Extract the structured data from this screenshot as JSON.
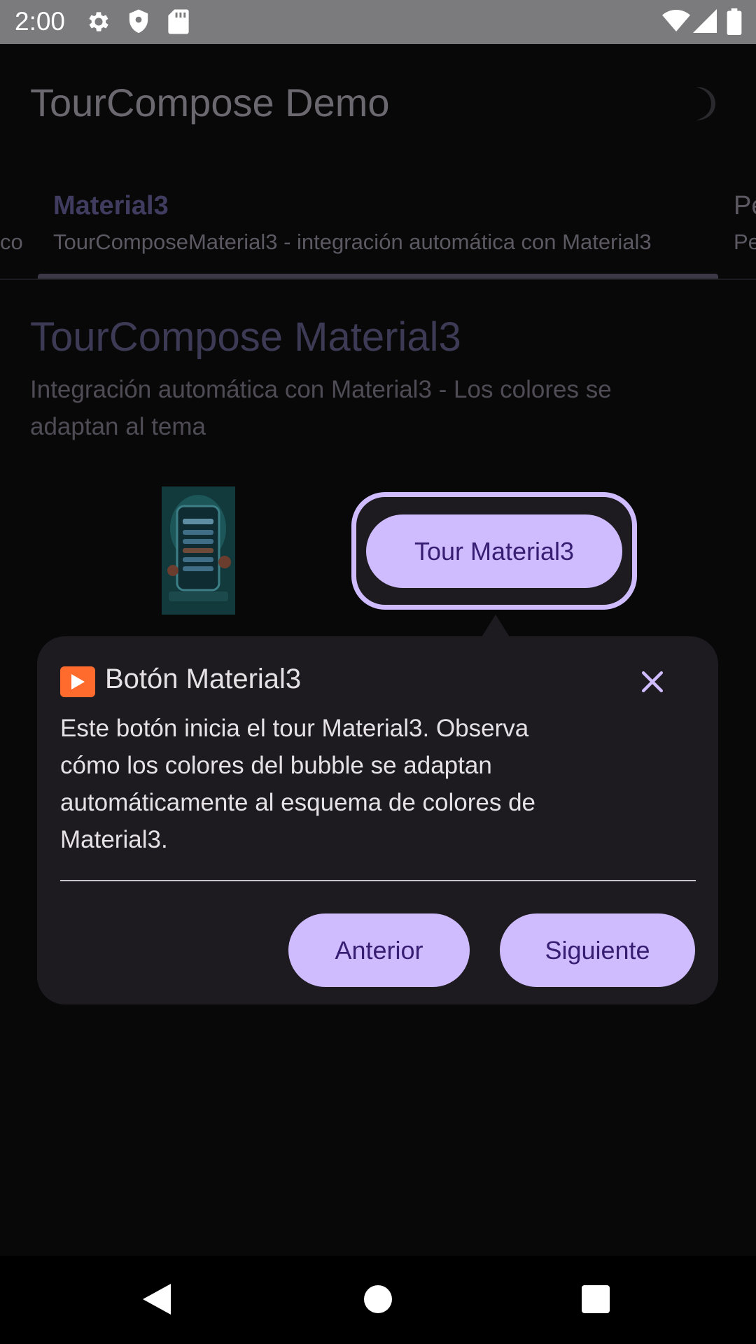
{
  "status_bar": {
    "time": "2:00",
    "left_icons": [
      "settings-icon",
      "shield-icon",
      "sd-card-icon"
    ],
    "right_icons": [
      "wifi-icon",
      "signal-icon",
      "battery-icon"
    ]
  },
  "app_bar": {
    "title": "TourCompose Demo",
    "theme_icon": "moon-icon"
  },
  "tabs": {
    "prev_fragment": "co",
    "selected": {
      "title": "Material3",
      "subtitle": "TourComposeMaterial3 - integración automática con Material3"
    },
    "next": {
      "title_fragment": "Pe",
      "subtitle_fragment": "Pe"
    }
  },
  "section": {
    "title": "TourCompose Material3",
    "description": "Integración automática con Material3 - Los colores se adaptan al tema"
  },
  "target_button": {
    "label": "Tour Material3"
  },
  "tooltip": {
    "icon": "play-button-icon",
    "title": "Botón Material3",
    "body": "Este botón inicia el tour Material3. Observa cómo los colores del bubble se adaptan automáticamente al esquema de colores de Material3.",
    "previous_label": "Anterior",
    "next_label": "Siguiente"
  },
  "nav_bar": {
    "icons": [
      "back-icon",
      "home-icon",
      "recents-icon"
    ]
  },
  "colors": {
    "accent": "#cfbcff",
    "on_accent": "#381e72",
    "surface": "#1d1b20",
    "scrim_background": "#080809"
  }
}
